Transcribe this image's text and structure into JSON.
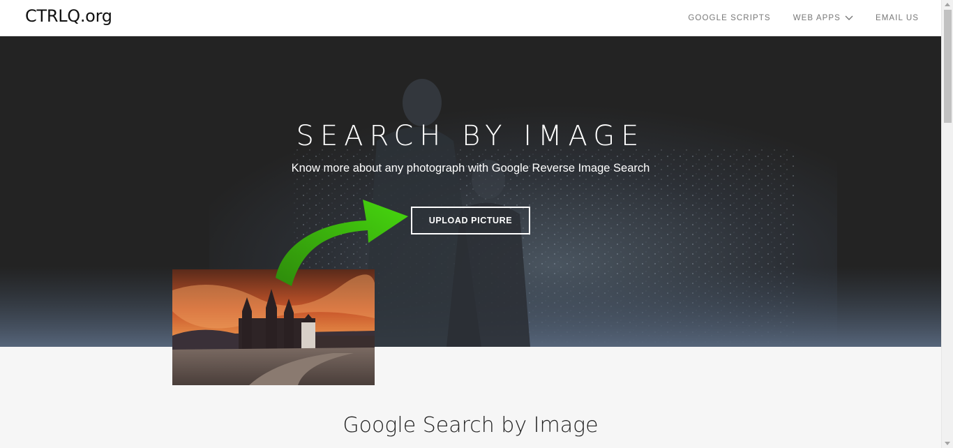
{
  "site": {
    "logo": "CTRLQ.org"
  },
  "nav": {
    "items": [
      {
        "label": "GOOGLE SCRIPTS",
        "has_dropdown": false
      },
      {
        "label": "WEB APPS",
        "has_dropdown": true,
        "icon": "chevron-down-icon"
      },
      {
        "label": "EMAIL US",
        "has_dropdown": false
      }
    ]
  },
  "hero": {
    "title": "SEARCH BY IMAGE",
    "subtitle": "Know more about any photograph with Google Reverse Image Search",
    "upload_label": "UPLOAD PICTURE"
  },
  "section": {
    "title": "Google Search by Image"
  },
  "colors": {
    "arrow": "#3fc40a",
    "hero_bg": "#232323",
    "navbar_bg": "#ffffff",
    "nav_text": "#777777"
  }
}
